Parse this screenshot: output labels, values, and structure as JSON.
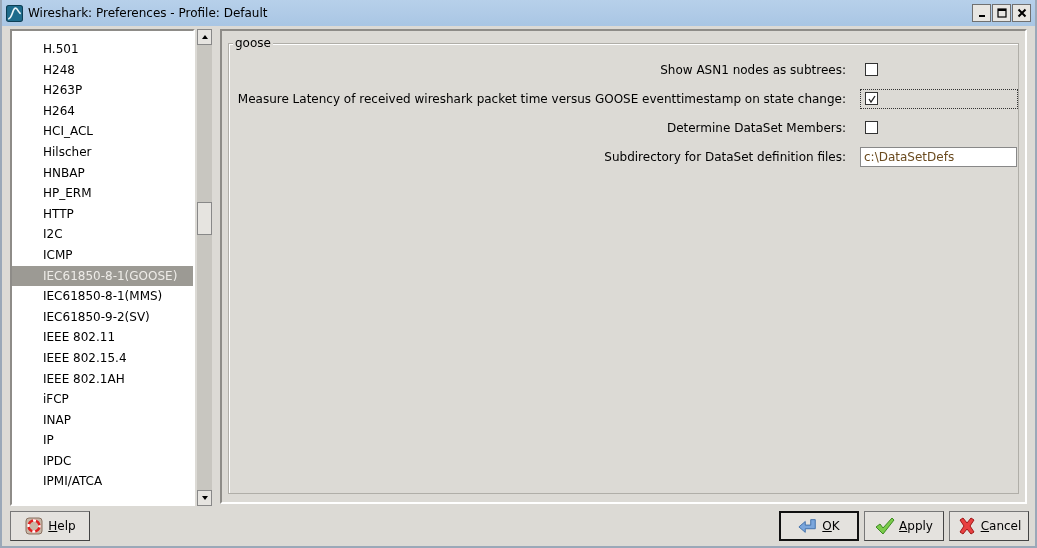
{
  "window": {
    "title": "Wireshark: Preferences - Profile: Default"
  },
  "sidebar": {
    "items": [
      {
        "label": "H.501",
        "selected": false
      },
      {
        "label": "H248",
        "selected": false
      },
      {
        "label": "H263P",
        "selected": false
      },
      {
        "label": "H264",
        "selected": false
      },
      {
        "label": "HCI_ACL",
        "selected": false
      },
      {
        "label": "Hilscher",
        "selected": false
      },
      {
        "label": "HNBAP",
        "selected": false
      },
      {
        "label": "HP_ERM",
        "selected": false
      },
      {
        "label": "HTTP",
        "selected": false
      },
      {
        "label": "I2C",
        "selected": false
      },
      {
        "label": "ICMP",
        "selected": false
      },
      {
        "label": "IEC61850-8-1(GOOSE)",
        "selected": true
      },
      {
        "label": "IEC61850-8-1(MMS)",
        "selected": false
      },
      {
        "label": "IEC61850-9-2(SV)",
        "selected": false
      },
      {
        "label": "IEEE 802.11",
        "selected": false
      },
      {
        "label": "IEEE 802.15.4",
        "selected": false
      },
      {
        "label": "IEEE 802.1AH",
        "selected": false
      },
      {
        "label": "iFCP",
        "selected": false
      },
      {
        "label": "INAP",
        "selected": false
      },
      {
        "label": "IP",
        "selected": false
      },
      {
        "label": "IPDC",
        "selected": false
      },
      {
        "label": "IPMI/ATCA",
        "selected": false
      }
    ]
  },
  "group": {
    "title": "goose",
    "settings": [
      {
        "kind": "checkbox",
        "label": "Show ASN1 nodes as subtrees:",
        "checked": false,
        "focused": false
      },
      {
        "kind": "checkbox",
        "label": "Measure Latency of received wireshark packet time versus GOOSE eventtimestamp on state change:",
        "checked": true,
        "focused": true
      },
      {
        "kind": "checkbox",
        "label": "Determine DataSet Members:",
        "checked": false,
        "focused": false
      },
      {
        "kind": "text",
        "label": "Subdirectory for DataSet definition files:",
        "value": "c:\\DataSetDefs"
      }
    ]
  },
  "buttons": [
    {
      "kind": "help",
      "label": "Help",
      "default": false
    },
    {
      "kind": "ok",
      "label": "OK",
      "default": true
    },
    {
      "kind": "apply",
      "label": "Apply",
      "default": false
    },
    {
      "kind": "cancel",
      "label": "Cancel",
      "default": false
    }
  ]
}
